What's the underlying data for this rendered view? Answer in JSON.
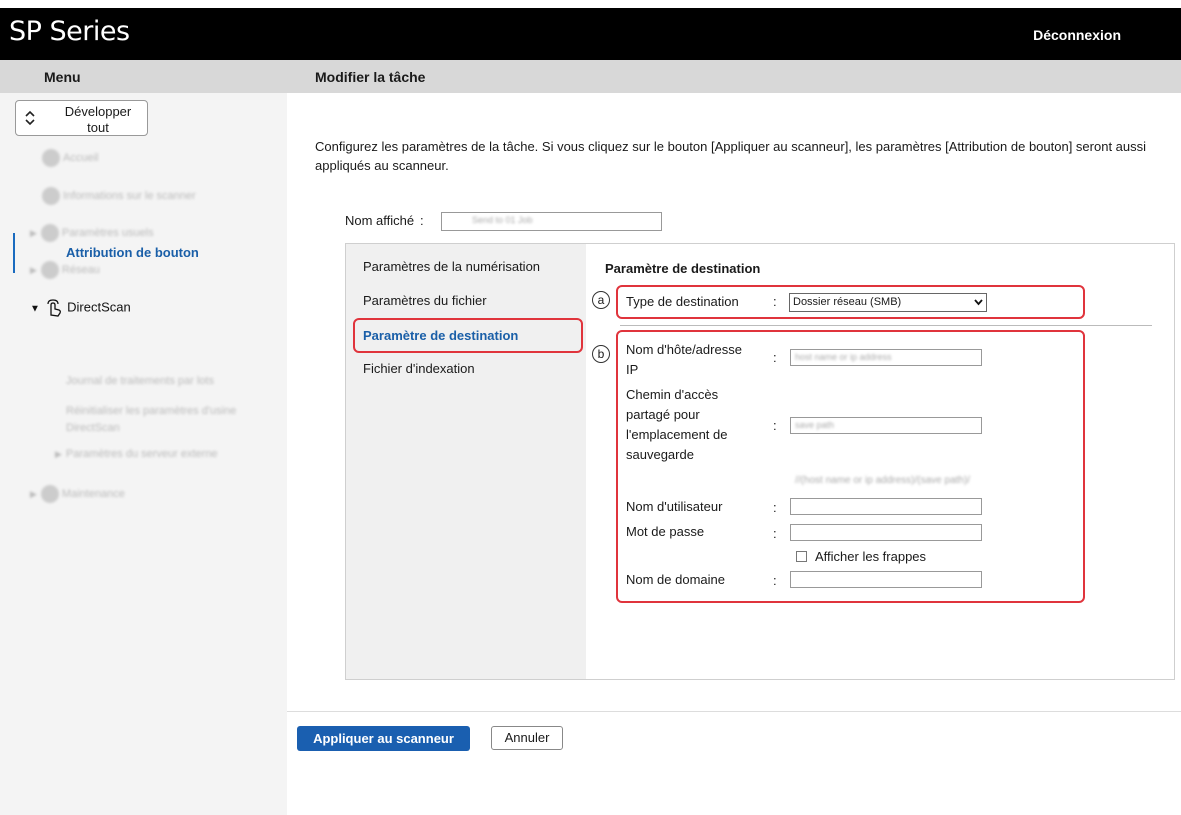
{
  "header": {
    "app_title": "SP Series",
    "logout": "Déconnexion",
    "menu_title": "Menu",
    "page_title": "Modifier la tâche"
  },
  "sidebar": {
    "expand_label": "Développer tout",
    "items": [
      {
        "label": "Accueil",
        "icon": "home-icon"
      },
      {
        "label": "Informations sur le scanner",
        "icon": "info-icon"
      },
      {
        "label": "Paramètres usuels",
        "icon": "settings-icon"
      },
      {
        "label": "Réseau",
        "icon": "network-icon"
      },
      {
        "label": "DirectScan",
        "icon": "directscan-icon"
      },
      {
        "label": "Attribution de bouton"
      },
      {
        "label": "Journal de traitements par lots"
      },
      {
        "label": "Réinitialiser les paramètres d'usine DirectScan"
      },
      {
        "label": "Paramètres du serveur externe"
      },
      {
        "label": "Maintenance",
        "icon": "maintenance-icon"
      }
    ]
  },
  "main": {
    "intro": "Configurez les paramètres de la tâche. Si vous cliquez sur le bouton [Appliquer au scanneur], les paramètres [Attribution de bouton] seront aussi appliqués au scanneur.",
    "name_label": "Nom affiché",
    "colon": ":",
    "name_value": "Send to 01 Job",
    "tabs": [
      {
        "label": "Paramètres de la numérisation"
      },
      {
        "label": "Paramètres du fichier"
      },
      {
        "label": "Paramètre de destination"
      },
      {
        "label": "Fichier d'indexation"
      }
    ],
    "section_title": "Paramètre de destination",
    "markers": {
      "a": "a",
      "b": "b"
    },
    "dest_type_label": "Type de destination",
    "dest_type_value": "Dossier réseau (SMB)",
    "host_label": "Nom d'hôte/adresse IP",
    "host_placeholder": "host name or ip address",
    "path_label": "Chemin d'accès partagé pour l'emplacement de sauvegarde",
    "path_placeholder": "save path",
    "path_hint": "//(host name or ip address)/(save path)/",
    "user_label": "Nom d'utilisateur",
    "password_label": "Mot de passe",
    "show_keys_label": "Afficher les frappes",
    "domain_label": "Nom de domaine"
  },
  "footer": {
    "apply": "Appliquer au scanneur",
    "cancel": "Annuler"
  },
  "colors": {
    "accent": "#1a5fb0",
    "highlight": "#e0343c",
    "header_bg": "#000000"
  }
}
